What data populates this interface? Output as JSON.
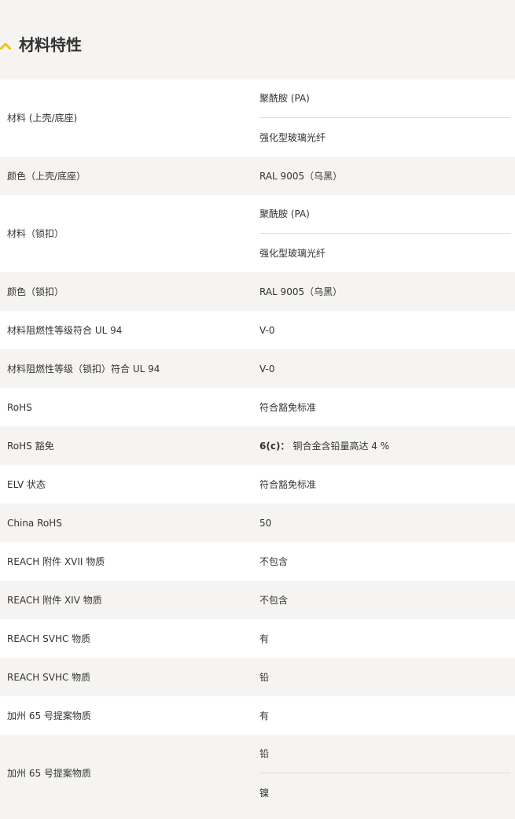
{
  "section": {
    "title": "材料特性",
    "icon": "chevron-up-icon",
    "icon_color": "#f0c419"
  },
  "rows": [
    {
      "label": "材料 (上壳/底座)",
      "values": [
        "聚酰胺 (PA)",
        "强化型玻璃光纤"
      ]
    },
    {
      "label": "颜色（上壳/底座）",
      "values": [
        "RAL 9005（乌黑）"
      ]
    },
    {
      "label": "材料（锁扣）",
      "values": [
        "聚酰胺 (PA)",
        "强化型玻璃光纤"
      ]
    },
    {
      "label": "颜色（锁扣）",
      "values": [
        "RAL 9005（乌黑）"
      ]
    },
    {
      "label": "材料阻燃性等级符合 UL 94",
      "values": [
        "V-0"
      ]
    },
    {
      "label": "材料阻燃性等级（锁扣）符合 UL 94",
      "values": [
        "V-0"
      ]
    },
    {
      "label": "RoHS",
      "values": [
        "符合豁免标准"
      ]
    },
    {
      "label": "RoHS 豁免",
      "values": [
        "铜合金含铅量高达 4 %"
      ],
      "value_prefix": "6(c)："
    },
    {
      "label": "ELV 状态",
      "values": [
        "符合豁免标准"
      ]
    },
    {
      "label": "China RoHS",
      "values": [
        "50"
      ]
    },
    {
      "label": "REACH 附件 XVII 物质",
      "values": [
        "不包含"
      ]
    },
    {
      "label": "REACH 附件 XIV 物质",
      "values": [
        "不包含"
      ]
    },
    {
      "label": "REACH SVHC 物质",
      "values": [
        "有"
      ]
    },
    {
      "label": "REACH SVHC 物质",
      "values": [
        "铅"
      ]
    },
    {
      "label": "加州 65 号提案物质",
      "values": [
        "有"
      ]
    },
    {
      "label": "加州 65 号提案物质",
      "values": [
        "铅",
        "镍"
      ]
    }
  ]
}
